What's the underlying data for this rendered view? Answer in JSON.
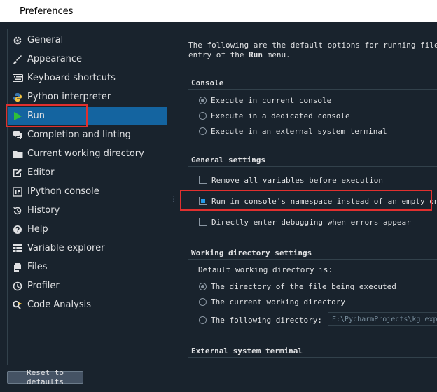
{
  "window": {
    "title": "Preferences"
  },
  "sidebar": {
    "items": [
      {
        "label": "General",
        "icon": "gear-icon"
      },
      {
        "label": "Appearance",
        "icon": "brush-icon"
      },
      {
        "label": "Keyboard shortcuts",
        "icon": "keyboard-icon"
      },
      {
        "label": "Python interpreter",
        "icon": "python-icon"
      },
      {
        "label": "Run",
        "icon": "play-icon",
        "selected": true
      },
      {
        "label": "Completion and linting",
        "icon": "chat-bubble-icon"
      },
      {
        "label": "Current working directory",
        "icon": "folder-icon"
      },
      {
        "label": "Editor",
        "icon": "edit-icon"
      },
      {
        "label": "IPython console",
        "icon": "console-icon"
      },
      {
        "label": "History",
        "icon": "history-icon"
      },
      {
        "label": "Help",
        "icon": "help-icon"
      },
      {
        "label": "Variable explorer",
        "icon": "table-icon"
      },
      {
        "label": "Files",
        "icon": "files-icon"
      },
      {
        "label": "Profiler",
        "icon": "clock-icon"
      },
      {
        "label": "Code Analysis",
        "icon": "code-analysis-icon"
      }
    ]
  },
  "content": {
    "intro_line1": "The following are the default options for running files.The",
    "intro_line2_prefix": "entry of the ",
    "intro_line2_bold": "Run",
    "intro_line2_suffix": " menu.",
    "console": {
      "title": "Console",
      "options": [
        {
          "label": "Execute in current console",
          "checked": true
        },
        {
          "label": "Execute in a dedicated console",
          "checked": false
        },
        {
          "label": "Execute in an external system terminal",
          "checked": false
        }
      ]
    },
    "general": {
      "title": "General settings",
      "options": [
        {
          "label": "Remove all variables before execution",
          "checked": false
        },
        {
          "label": "Run in console's namespace instead of an empty one",
          "checked": true
        },
        {
          "label": "Directly enter debugging when errors appear",
          "checked": false
        }
      ]
    },
    "workdir": {
      "title": "Working directory settings",
      "label": "Default working directory is:",
      "options": [
        {
          "label": "The directory of the file being executed",
          "checked": true
        },
        {
          "label": "The current working directory",
          "checked": false
        },
        {
          "label": "The following directory:",
          "checked": false
        }
      ],
      "directory_value": "E:\\PycharmProjects\\kg exp"
    },
    "external": {
      "title": "External system terminal"
    }
  },
  "footer": {
    "reset_label": "Reset to defaults"
  },
  "colors": {
    "selection": "#1464a0",
    "highlight": "#e0302f",
    "accent": "#259ae9"
  }
}
